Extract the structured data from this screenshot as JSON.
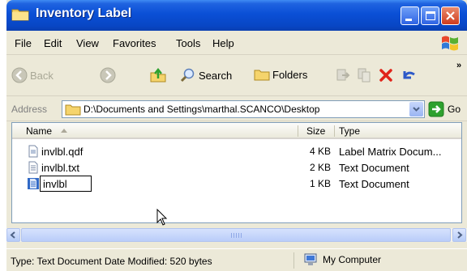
{
  "window": {
    "title": "Inventory Label",
    "controls": {
      "minimize": "minimize",
      "maximize": "maximize",
      "close": "close"
    }
  },
  "menubar": {
    "items": [
      "File",
      "Edit",
      "View",
      "Favorites",
      "Tools",
      "Help"
    ]
  },
  "toolbar": {
    "back_label": "Back",
    "search_label": "Search",
    "folders_label": "Folders",
    "more": "»"
  },
  "address": {
    "label": "Address",
    "path": "D:\\Documents and Settings\\marthal.SCANCO\\Desktop",
    "go_label": "Go"
  },
  "filelist": {
    "columns": {
      "name": "Name",
      "size": "Size",
      "type": "Type"
    },
    "rows": [
      {
        "name": "invlbl.qdf",
        "size": "4 KB",
        "type": "Label Matrix Docum...",
        "icon": "label-matrix-icon"
      },
      {
        "name": "invlbl.txt",
        "size": "2 KB",
        "type": "Text Document",
        "icon": "text-document-icon"
      },
      {
        "name": "invlbl",
        "size": "1 KB",
        "type": "Text Document",
        "icon": "text-document-icon",
        "renaming": true
      }
    ]
  },
  "statusbar": {
    "left": "Type: Text Document Date Modified: 520 bytes",
    "right": "My Computer"
  },
  "colors": {
    "titlebar": "#0a4fd6",
    "chrome": "#ece9d8",
    "close_button": "#cf3b1d",
    "go_green": "#2ea12e"
  }
}
